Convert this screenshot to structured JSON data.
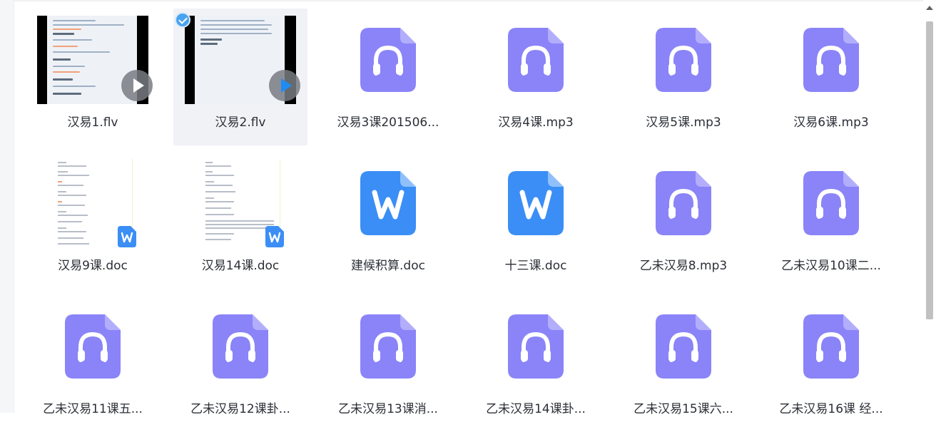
{
  "files": [
    {
      "name": "汉易1.flv",
      "type": "video",
      "selected": false
    },
    {
      "name": "汉易2.flv",
      "type": "video",
      "selected": true
    },
    {
      "name": "汉易3课201506...",
      "type": "audio",
      "selected": false
    },
    {
      "name": "汉易4课.mp3",
      "type": "audio",
      "selected": false
    },
    {
      "name": "汉易5课.mp3",
      "type": "audio",
      "selected": false
    },
    {
      "name": "汉易6课.mp3",
      "type": "audio",
      "selected": false
    },
    {
      "name": "汉易9课.doc",
      "type": "doc-thumb",
      "selected": false
    },
    {
      "name": "汉易14课.doc",
      "type": "doc-thumb",
      "selected": false
    },
    {
      "name": "建候积算.doc",
      "type": "word",
      "selected": false
    },
    {
      "name": "十三课.doc",
      "type": "word",
      "selected": false
    },
    {
      "name": "乙未汉易8.mp3",
      "type": "audio",
      "selected": false
    },
    {
      "name": "乙未汉易10课二...",
      "type": "audio",
      "selected": false
    },
    {
      "name": "乙未汉易11课五...",
      "type": "audio",
      "selected": false
    },
    {
      "name": "乙未汉易12课卦...",
      "type": "audio",
      "selected": false
    },
    {
      "name": "乙未汉易13课消...",
      "type": "audio",
      "selected": false
    },
    {
      "name": "乙未汉易14课卦...",
      "type": "audio",
      "selected": false
    },
    {
      "name": "乙未汉易15课六...",
      "type": "audio",
      "selected": false
    },
    {
      "name": "乙未汉易16课 经...",
      "type": "audio",
      "selected": false
    }
  ],
  "icons": {
    "audio": "headphones-file-icon",
    "word": "word-file-icon",
    "video": "video-thumbnail",
    "doc-thumb": "document-thumbnail",
    "play": "play-icon",
    "check": "check-icon"
  },
  "colors": {
    "audio_icon": "#8a84f8",
    "word_icon": "#3b8ef5",
    "selected_tile": "#f0f2f6",
    "text": "#2b2f36",
    "check": "#4aa3f0"
  }
}
